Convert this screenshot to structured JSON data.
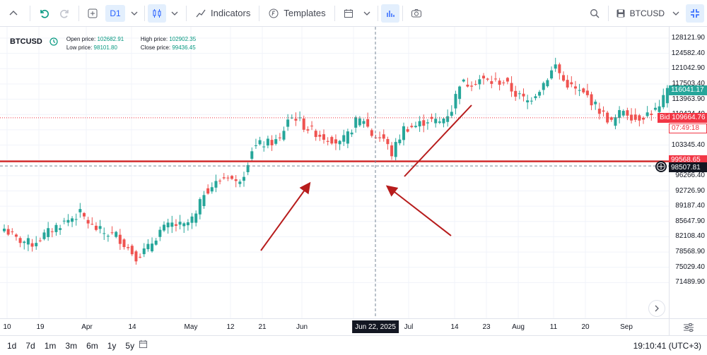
{
  "toolbar": {
    "timeframe": "D1",
    "indicators_label": "Indicators",
    "templates_label": "Templates",
    "symbol": "BTCUSD"
  },
  "legend": {
    "symbol": "BTCUSD",
    "open_label": "Open price:",
    "open_value": "102682.91",
    "high_label": "High price:",
    "high_value": "102902.35",
    "low_label": "Low price:",
    "low_value": "98101.80",
    "close_label": "Close price:",
    "close_value": "99436.45"
  },
  "price_scale": {
    "ticks": [
      "128121.90",
      "124582.40",
      "121042.90",
      "117503.40",
      "113963.90",
      "110424.40",
      "106884.90",
      "103345.40",
      "99805.90",
      "96266.40",
      "92726.90",
      "89187.40",
      "85647.90",
      "82108.40",
      "78568.90",
      "75029.40",
      "71489.90"
    ],
    "labels": {
      "last": "116041.17",
      "bid": "Bid 109664.76",
      "countdown": "07:49:18",
      "level": "99568.65",
      "crosshair": "98507.81"
    }
  },
  "time_axis": {
    "ticks": [
      "10",
      "19",
      "Apr",
      "14",
      "May",
      "12",
      "21",
      "Jun",
      "Jul",
      "14",
      "23",
      "Aug",
      "11",
      "20",
      "Sep"
    ],
    "crosshair_label": "Jun 22, 2025"
  },
  "bottom_bar": {
    "ranges": [
      "1d",
      "7d",
      "1m",
      "3m",
      "6m",
      "1y",
      "5y"
    ],
    "clock": "19:10:41 (UTC+3)"
  },
  "colors": {
    "up": "#26a69a",
    "down": "#ef5350",
    "level_line": "#d32f2f",
    "arrow": "#b71c1c",
    "bid": "#f23645"
  },
  "chart_data": {
    "type": "candlestick",
    "symbol": "BTCUSD",
    "timeframe": "D1",
    "x_range": [
      "Mar 10",
      "Sep 12"
    ],
    "ylim": [
      71489.9,
      131000
    ],
    "horizontal_line": 99568.65,
    "annotations": [
      "arrow to support Jun 5",
      "arrow from below to Jun 22 low",
      "arrow to support Jun 22",
      "arrow trend up Jul"
    ],
    "ohlc_anchor_closes": [
      [
        0,
        84000
      ],
      [
        3,
        81500
      ],
      [
        7,
        80500
      ],
      [
        10,
        82500
      ],
      [
        13,
        84500
      ],
      [
        16,
        86000
      ],
      [
        19,
        87500
      ],
      [
        22,
        84500
      ],
      [
        25,
        83000
      ],
      [
        28,
        82500
      ],
      [
        30,
        80500
      ],
      [
        33,
        77500
      ],
      [
        36,
        79500
      ],
      [
        39,
        83500
      ],
      [
        42,
        85000
      ],
      [
        45,
        84500
      ],
      [
        48,
        87000
      ],
      [
        50,
        92500
      ],
      [
        53,
        94500
      ],
      [
        56,
        96500
      ],
      [
        58,
        94500
      ],
      [
        60,
        97000
      ],
      [
        62,
        102500
      ],
      [
        64,
        103500
      ],
      [
        66,
        103800
      ],
      [
        69,
        104500
      ],
      [
        71,
        109500
      ],
      [
        73,
        109800
      ],
      [
        75,
        107800
      ],
      [
        78,
        106200
      ],
      [
        80,
        105200
      ],
      [
        82,
        104800
      ],
      [
        84,
        103500
      ],
      [
        86,
        105600
      ],
      [
        88,
        108800
      ],
      [
        90,
        109300
      ],
      [
        92,
        105800
      ],
      [
        95,
        104800
      ],
      [
        97,
        101300
      ],
      [
        100,
        107200
      ],
      [
        103,
        107800
      ],
      [
        106,
        109200
      ],
      [
        109,
        108600
      ],
      [
        112,
        111600
      ],
      [
        114,
        117800
      ],
      [
        116,
        117600
      ],
      [
        119,
        118600
      ],
      [
        122,
        117900
      ],
      [
        125,
        118100
      ],
      [
        128,
        115200
      ],
      [
        131,
        113500
      ],
      [
        134,
        116400
      ],
      [
        136,
        119100
      ],
      [
        138,
        121800
      ],
      [
        140,
        118200
      ],
      [
        143,
        116100
      ],
      [
        146,
        114600
      ],
      [
        149,
        111400
      ],
      [
        152,
        108500
      ],
      [
        155,
        111600
      ],
      [
        158,
        109400
      ],
      [
        161,
        110600
      ],
      [
        164,
        111800
      ],
      [
        166,
        116000
      ]
    ]
  }
}
